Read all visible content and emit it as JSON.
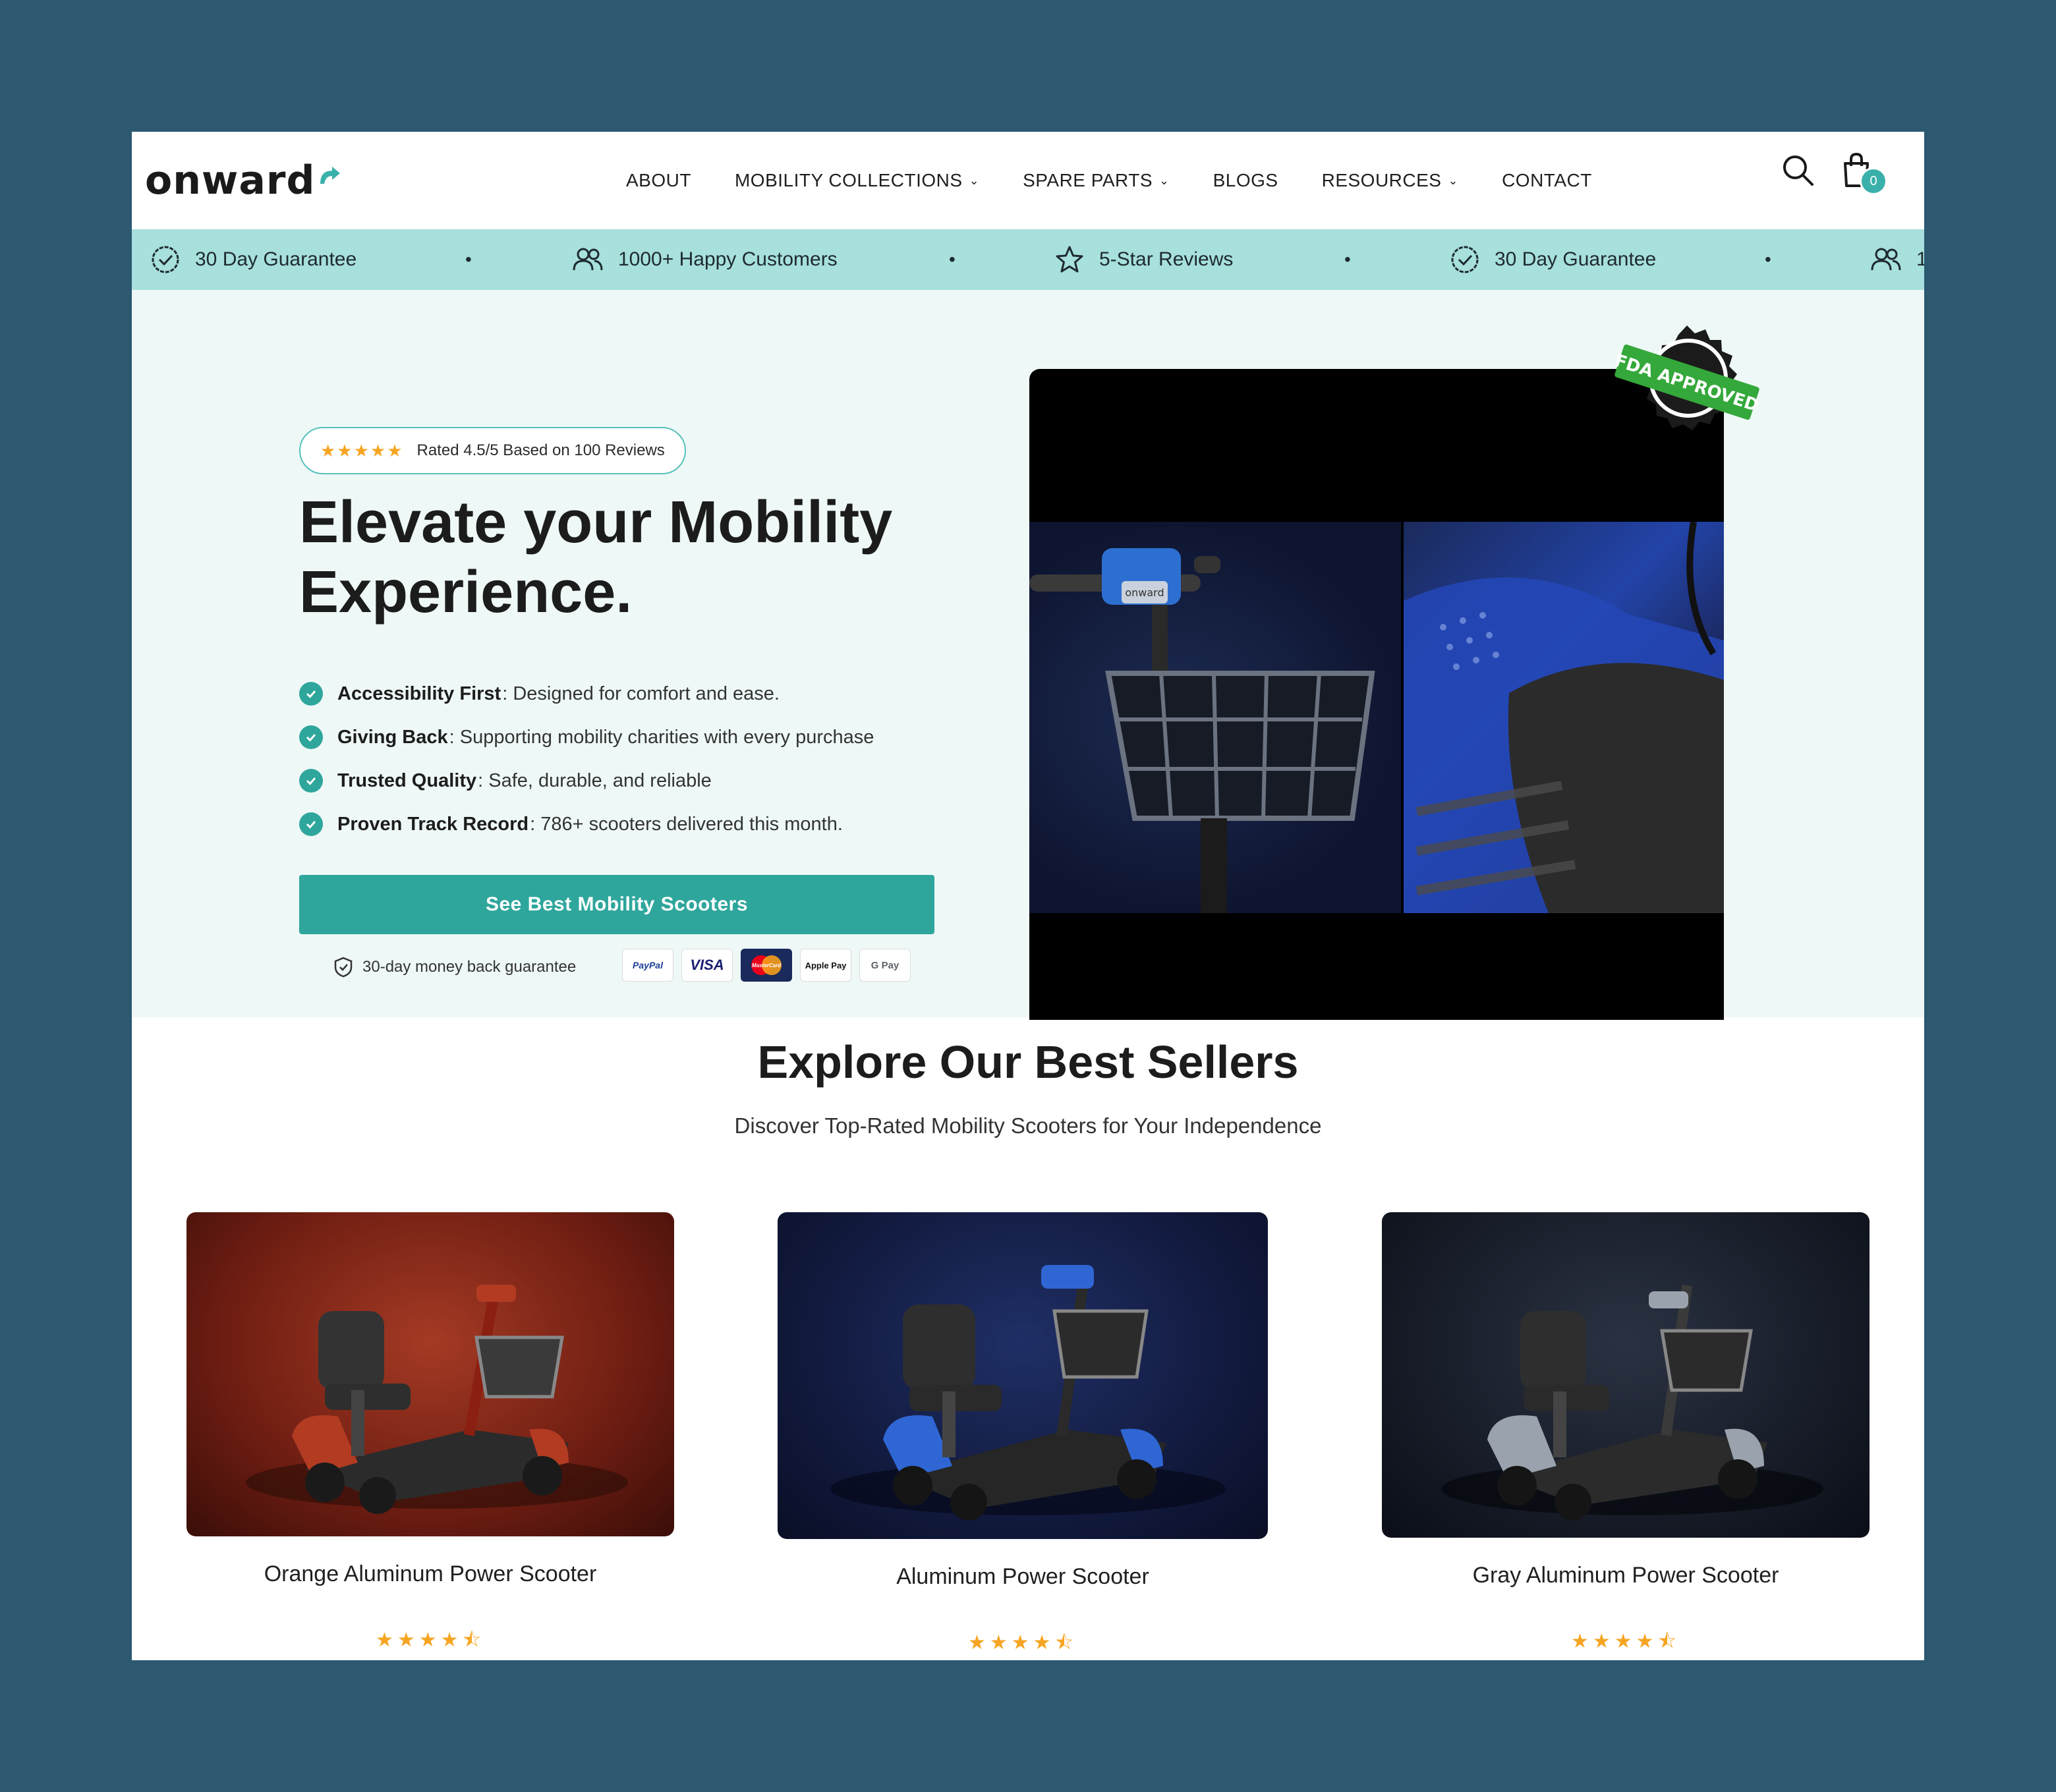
{
  "brand": {
    "logo_text": "onward"
  },
  "nav": {
    "items": [
      {
        "label": "ABOUT",
        "has_dropdown": false
      },
      {
        "label": "MOBILITY COLLECTIONS",
        "has_dropdown": true
      },
      {
        "label": "SPARE PARTS",
        "has_dropdown": true
      },
      {
        "label": "BLOGS",
        "has_dropdown": false
      },
      {
        "label": "RESOURCES",
        "has_dropdown": true
      },
      {
        "label": "CONTACT",
        "has_dropdown": false
      }
    ]
  },
  "header_icons": {
    "search": "search-icon",
    "cart": "shopping-bag-icon",
    "cart_count": "0"
  },
  "ticker": {
    "items": [
      {
        "label": "30 Day Guarantee",
        "icon": "badge-check-icon"
      },
      {
        "label": "1000+ Happy Customers",
        "icon": "users-icon"
      },
      {
        "label": "5-Star Reviews",
        "icon": "star-icon"
      },
      {
        "label": "30 Day Guarantee",
        "icon": "badge-check-icon"
      },
      {
        "label": "1",
        "icon": "users-icon"
      }
    ]
  },
  "hero": {
    "rating": {
      "stars": "★★★★★",
      "text": "Rated 4.5/5 Based on 100 Reviews"
    },
    "title_line1": "Elevate your Mobility",
    "title_line2": "Experience.",
    "features": [
      {
        "bold": "Accessibility First",
        "text": ": Designed for comfort and ease."
      },
      {
        "bold": "Giving Back",
        "text": ": Supporting mobility charities with every purchase"
      },
      {
        "bold": "Trusted Quality",
        "text": ": Safe, durable, and reliable"
      },
      {
        "bold": "Proven Track Record",
        "text": ": 786+ scooters delivered this month."
      }
    ],
    "cta_label": "See Best Mobility Scooters",
    "guarantee_text": "30-day money back guarantee",
    "payments": [
      "PayPal",
      "VISA",
      "MasterCard",
      "Apple Pay",
      "G Pay"
    ],
    "badge": {
      "main": "FDA APPROVED",
      "ring": "FDA APPROVED"
    },
    "scooter_display": "onward"
  },
  "best_sellers": {
    "title": "Explore Our Best Sellers",
    "subtitle": "Discover Top-Rated Mobility Scooters for Your Independence",
    "products": [
      {
        "name": "Orange Aluminum Power Scooter",
        "stars": "★★★★⯪",
        "rating": 4.5,
        "accent": "#b5391e"
      },
      {
        "name": "Aluminum Power Scooter",
        "stars": "★★★★⯪",
        "rating": 4.5,
        "accent": "#2a62c9"
      },
      {
        "name": "Gray Aluminum Power Scooter",
        "stars": "★★★★⯪",
        "rating": 4.5,
        "accent": "#9aa3ad"
      }
    ]
  },
  "colors": {
    "teal": "#2ea69c",
    "ticker_bg": "#a7e0dc",
    "hero_bg": "#eef8f7",
    "star": "#f6a523",
    "outer_bg": "#2c5870"
  }
}
